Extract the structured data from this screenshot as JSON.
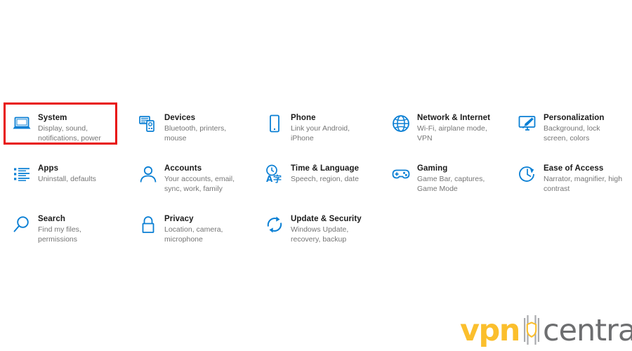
{
  "page": {
    "background_color": "#ffffff",
    "icon_color": "#0a7fd4",
    "title_color": "#1a1a1a",
    "subtitle_color": "#767676",
    "highlight_color": "#e8110e"
  },
  "settings": {
    "rows": [
      [
        {
          "id": "system",
          "icon": "laptop-icon",
          "title": "System",
          "subtitle": "Display, sound, notifications, power",
          "highlighted": true
        },
        {
          "id": "devices",
          "icon": "devices-icon",
          "title": "Devices",
          "subtitle": "Bluetooth, printers, mouse",
          "highlighted": false
        },
        {
          "id": "phone",
          "icon": "phone-icon",
          "title": "Phone",
          "subtitle": "Link your Android, iPhone",
          "highlighted": false
        },
        {
          "id": "network-internet",
          "icon": "globe-icon",
          "title": "Network & Internet",
          "subtitle": "Wi-Fi, airplane mode, VPN",
          "highlighted": false
        },
        {
          "id": "personalization",
          "icon": "paintbrush-monitor-icon",
          "title": "Personalization",
          "subtitle": "Background, lock screen, colors",
          "highlighted": false
        }
      ],
      [
        {
          "id": "apps",
          "icon": "list-icon",
          "title": "Apps",
          "subtitle": "Uninstall, defaults",
          "highlighted": false
        },
        {
          "id": "accounts",
          "icon": "person-icon",
          "title": "Accounts",
          "subtitle": "Your accounts, email, sync, work, family",
          "highlighted": false
        },
        {
          "id": "time-language",
          "icon": "clock-language-icon",
          "title": "Time & Language",
          "subtitle": "Speech, region, date",
          "highlighted": false
        },
        {
          "id": "gaming",
          "icon": "gamepad-icon",
          "title": "Gaming",
          "subtitle": "Game Bar, captures, Game Mode",
          "highlighted": false
        },
        {
          "id": "ease-of-access",
          "icon": "accessibility-clock-icon",
          "title": "Ease of Access",
          "subtitle": "Narrator, magnifier, high contrast",
          "highlighted": false
        }
      ],
      [
        {
          "id": "search",
          "icon": "search-icon",
          "title": "Search",
          "subtitle": "Find my files, permissions",
          "highlighted": false
        },
        {
          "id": "privacy",
          "icon": "lock-icon",
          "title": "Privacy",
          "subtitle": "Location, camera, microphone",
          "highlighted": false
        },
        {
          "id": "update-security",
          "icon": "refresh-icon",
          "title": "Update & Security",
          "subtitle": "Windows Update, recovery, backup",
          "highlighted": false
        }
      ]
    ]
  },
  "watermark": {
    "primary_text": "vpn",
    "secondary_text": "central",
    "primary_color": "#fbbf2d",
    "secondary_color": "#6d6e70",
    "mark": "shield-bars-icon"
  }
}
